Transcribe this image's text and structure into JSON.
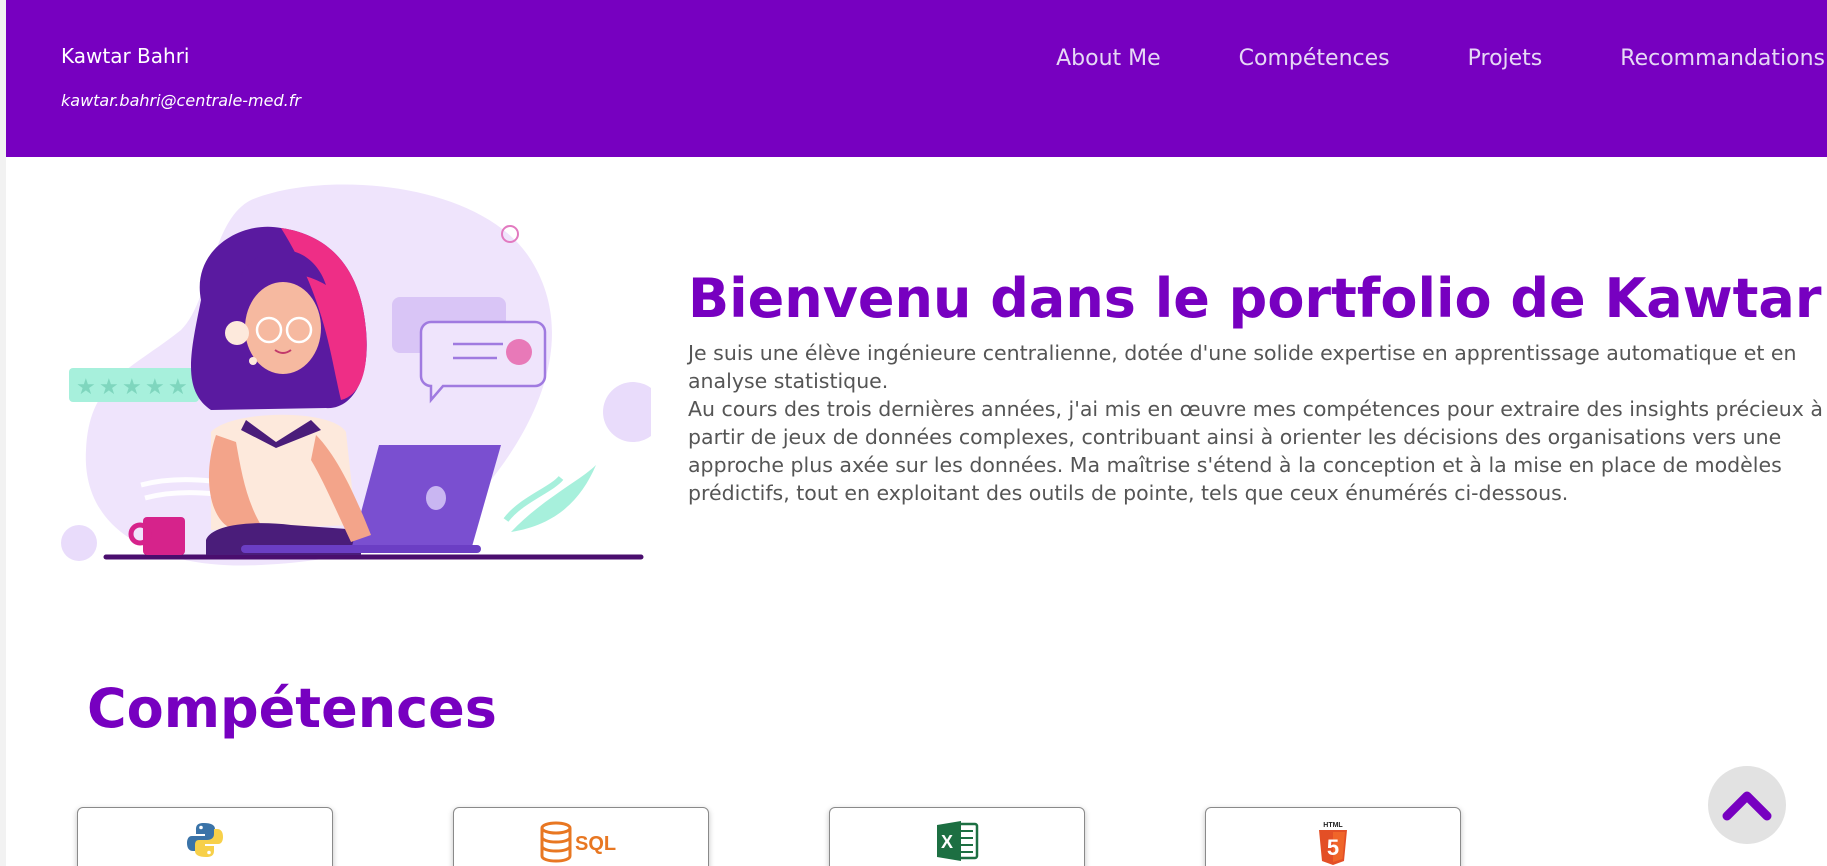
{
  "header": {
    "name": "Kawtar Bahri",
    "email": "kawtar.bahri@centrale-med.fr",
    "nav": [
      "About Me",
      "Compétences",
      "Projets",
      "Recommandations"
    ]
  },
  "hero": {
    "title": "Bienvenu dans le portfolio de Kawtar !",
    "paragraph1": "Je suis une élève ingénieure centralienne, dotée d'une solide expertise en apprentissage automatique et en analyse statistique.",
    "paragraph2": "Au cours des trois dernières années, j'ai mis en œuvre mes compétences pour extraire des insights précieux à partir de jeux de données complexes, contribuant ainsi à orienter les décisions des organisations vers une approche plus axée sur les données. Ma maîtrise s'étend à la conception et à la mise en place de modèles prédictifs, tout en exploitant des outils de pointe, tels que ceux énumérés ci-dessous."
  },
  "skills": {
    "title": "Compétences",
    "cards": [
      {
        "icon": "python-icon"
      },
      {
        "icon": "sql-icon",
        "label": "SQL"
      },
      {
        "icon": "excel-icon",
        "label": "X"
      },
      {
        "icon": "html5-icon",
        "label": "HTML",
        "number": "5"
      }
    ]
  },
  "colors": {
    "brand": "#7700c0",
    "nav_text": "#e6d8f5",
    "body_text": "#555555",
    "sql_orange": "#e87722",
    "excel_green": "#1d6f42",
    "html_orange": "#e34f26"
  }
}
